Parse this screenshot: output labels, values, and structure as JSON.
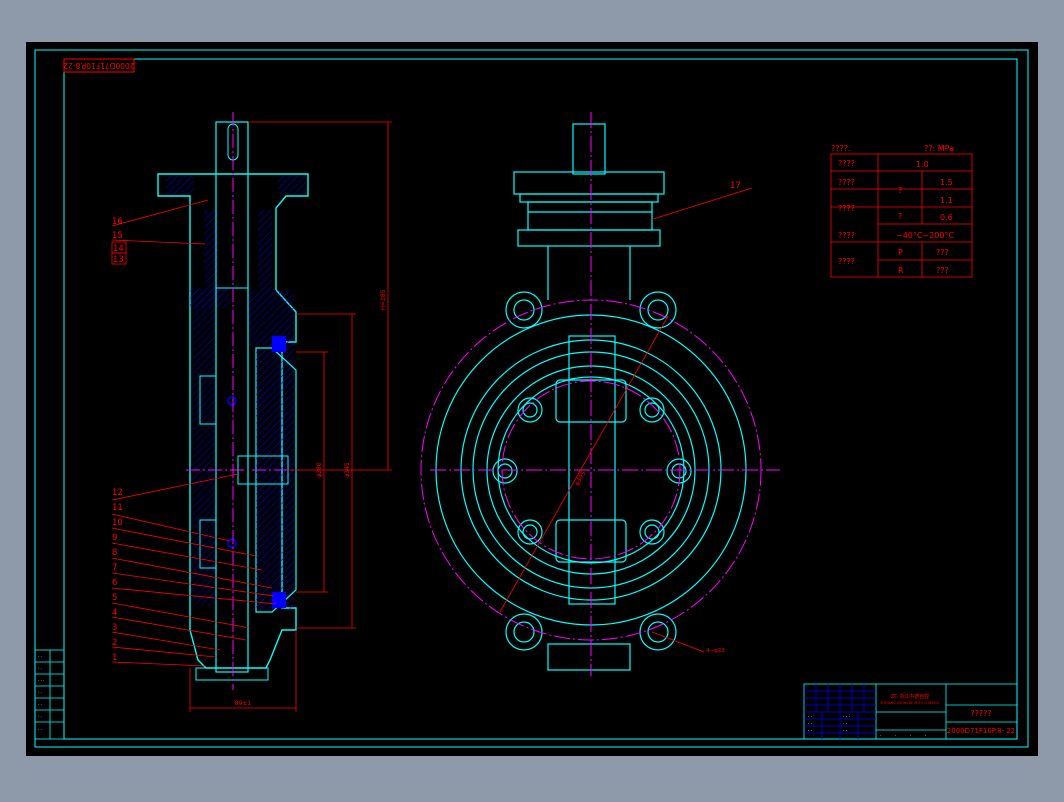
{
  "drawing": {
    "title_code_rotated": "2000D71F10P.8-22",
    "title_code": "2000D71F10P.8- 22",
    "title_block_name": "?????",
    "company_line1": "ZC 浙江中德自控",
    "company_line2": "ZHEJIANG ZHONGDE AUTO CONTROL",
    "colors": {
      "background": "#000000",
      "frame": "#00ffff",
      "red": "#ff0000",
      "magenta": "#ff00ff",
      "blue": "#0000ff"
    }
  },
  "spec_table": {
    "header_left": "????.",
    "header_right": "??:  MPa",
    "rows": [
      {
        "label": "????",
        "value": "1.0"
      },
      {
        "label": "????",
        "sub": "?",
        "value": "1.5"
      },
      {
        "label": "",
        "sub": "",
        "value": "1.1"
      },
      {
        "label": "????",
        "sub": "?",
        "value": "0.6"
      },
      {
        "label": "????",
        "value": "−40°C∼200°C"
      },
      {
        "label": "????",
        "sub": "P",
        "value": "???"
      },
      {
        "label": "",
        "sub": "R",
        "value": "???"
      }
    ]
  },
  "part_labels": [
    "16",
    "15",
    "14",
    "13",
    "12",
    "11",
    "10",
    "9",
    "8",
    "7",
    "6",
    "5",
    "4",
    "3",
    "2",
    "1",
    "17"
  ],
  "dimensions": {
    "height_total": "H=285",
    "bore_inner": "φ280",
    "bore_outer": "φ345",
    "bottom_width": "89±1",
    "pcd": "φ395",
    "holes": "4−φ23"
  }
}
